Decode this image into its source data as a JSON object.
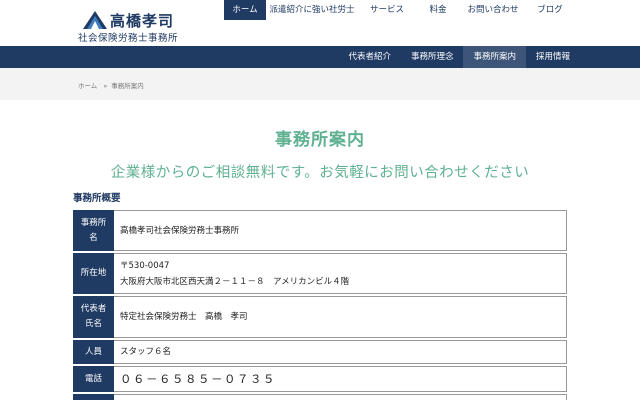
{
  "logo": {
    "name": "高橋孝司",
    "subtitle": "社会保険労務士事務所",
    "mark_colors": [
      "#1f3a63",
      "#3f7fc1"
    ]
  },
  "top_nav": [
    {
      "label": "ホーム",
      "active": true
    },
    {
      "label": "派遣紹介に強い社労士",
      "active": false
    },
    {
      "label": "サービス",
      "active": false
    },
    {
      "label": "料金",
      "active": false
    },
    {
      "label": "お問い合わせ",
      "active": false
    },
    {
      "label": "ブログ",
      "active": false
    }
  ],
  "sub_nav": [
    {
      "label": "代表者紹介",
      "active": false
    },
    {
      "label": "事務所理念",
      "active": false
    },
    {
      "label": "事務所案内",
      "active": true
    },
    {
      "label": "採用情報",
      "active": false
    }
  ],
  "breadcrumb": {
    "home": "ホーム",
    "separator": "»",
    "current": "事務所案内"
  },
  "page": {
    "title": "事務所案内",
    "lead": "企業様からのご相談無料です。お気軽にお問い合わせください",
    "section_heading": "事務所概要"
  },
  "office_table": [
    {
      "label": "事務所名",
      "lines": [
        "高橋孝司社会保険労務士事務所"
      ]
    },
    {
      "label": "所在地",
      "lines": [
        "〒530-0047",
        "大阪府大阪市北区西天満２－１１－８　アメリカンビル４階"
      ]
    },
    {
      "label": "代表者氏名",
      "lines": [
        "特定社会保険労務士　高橋　孝司"
      ]
    },
    {
      "label": "人員",
      "lines": [
        "スタッフ６名"
      ]
    },
    {
      "label": "電話",
      "lines": [
        "０６－６５８５－０７３５"
      ]
    },
    {
      "label": "",
      "lines": [
        ""
      ]
    }
  ],
  "colors": {
    "navy": "#1f3a63",
    "accent_green": "#5fb191",
    "breadcrumb_bg": "#f3f3f3"
  }
}
